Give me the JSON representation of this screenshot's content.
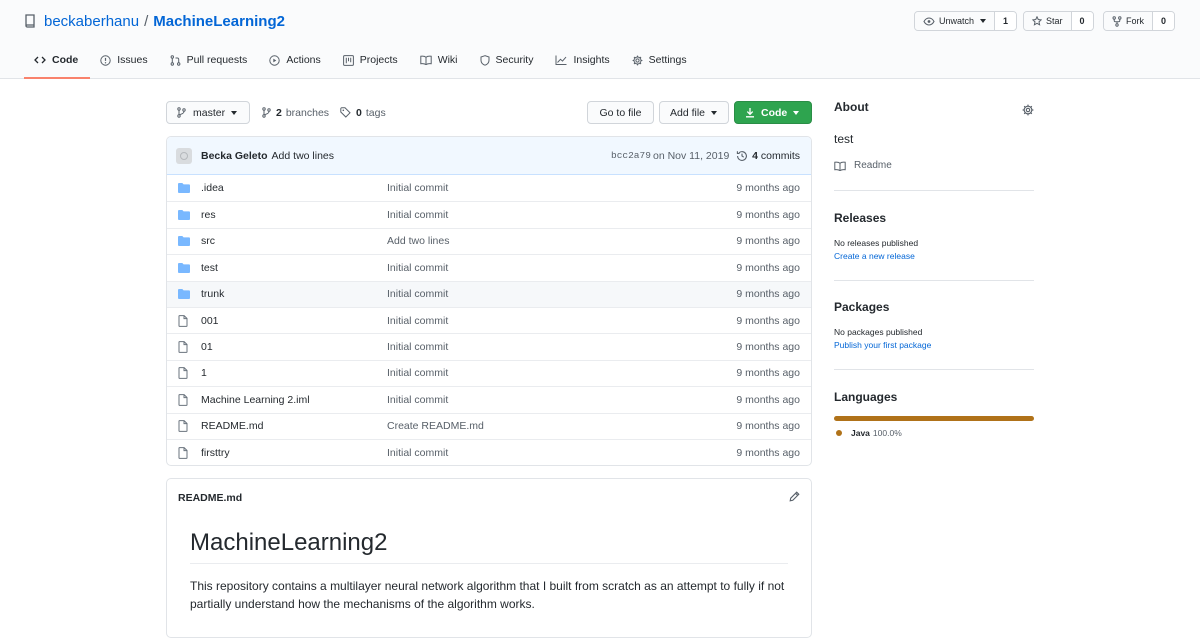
{
  "repo": {
    "owner": "beckaberhanu",
    "separator": "/",
    "name": "MachineLearning2"
  },
  "header_actions": {
    "watch": {
      "label": "Unwatch",
      "count": "1"
    },
    "star": {
      "label": "Star",
      "count": "0"
    },
    "fork": {
      "label": "Fork",
      "count": "0"
    }
  },
  "tabs": [
    {
      "label": "Code",
      "icon": "code-icon",
      "active": true
    },
    {
      "label": "Issues",
      "icon": "issue-icon"
    },
    {
      "label": "Pull requests",
      "icon": "pull-request-icon"
    },
    {
      "label": "Actions",
      "icon": "play-icon"
    },
    {
      "label": "Projects",
      "icon": "project-icon"
    },
    {
      "label": "Wiki",
      "icon": "book-icon"
    },
    {
      "label": "Security",
      "icon": "shield-icon"
    },
    {
      "label": "Insights",
      "icon": "graph-icon"
    },
    {
      "label": "Settings",
      "icon": "gear-icon"
    }
  ],
  "toolbar": {
    "branch": "master",
    "branches_count": "2",
    "branches_label": "branches",
    "tags_count": "0",
    "tags_label": "tags",
    "go_to_file": "Go to file",
    "add_file": "Add file",
    "code": "Code"
  },
  "latest_commit": {
    "author": "Becka Geleto",
    "message": "Add two lines",
    "sha": "bcc2a79",
    "date": "on Nov 11, 2019",
    "count": "4",
    "count_label": "commits"
  },
  "files": [
    {
      "name": ".idea",
      "type": "dir",
      "message": "Initial commit",
      "age": "9 months ago"
    },
    {
      "name": "res",
      "type": "dir",
      "message": "Initial commit",
      "age": "9 months ago"
    },
    {
      "name": "src",
      "type": "dir",
      "message": "Add two lines",
      "age": "9 months ago"
    },
    {
      "name": "test",
      "type": "dir",
      "message": "Initial commit",
      "age": "9 months ago"
    },
    {
      "name": "trunk",
      "type": "dir",
      "message": "Initial commit",
      "age": "9 months ago"
    },
    {
      "name": "001",
      "type": "file",
      "message": "Initial commit",
      "age": "9 months ago"
    },
    {
      "name": "01",
      "type": "file",
      "message": "Initial commit",
      "age": "9 months ago"
    },
    {
      "name": "1",
      "type": "file",
      "message": "Initial commit",
      "age": "9 months ago"
    },
    {
      "name": "Machine Learning 2.iml",
      "type": "file",
      "message": "Initial commit",
      "age": "9 months ago"
    },
    {
      "name": "README.md",
      "type": "file",
      "message": "Create README.md",
      "age": "9 months ago"
    },
    {
      "name": "firsttry",
      "type": "file",
      "message": "Initial commit",
      "age": "9 months ago"
    }
  ],
  "readme": {
    "filename": "README.md",
    "title": "MachineLearning2",
    "body": "This repository contains a multilayer neural network algorithm that I built from scratch as an attempt to fully if not partially understand how the mechanisms of the algorithm works."
  },
  "sidebar": {
    "about_title": "About",
    "description": "test",
    "readme_link": "Readme",
    "releases_title": "Releases",
    "releases_none": "No releases published",
    "releases_link": "Create a new release",
    "packages_title": "Packages",
    "packages_none": "No packages published",
    "packages_link": "Publish your first package",
    "languages_title": "Languages",
    "languages": [
      {
        "name": "Java",
        "percent": "100.0%",
        "color": "#b07219"
      }
    ]
  },
  "colors": {
    "link": "#0366d6",
    "active_tab_underline": "#f9826c",
    "code_button": "#2ea44f",
    "folder": "#79b8ff"
  }
}
